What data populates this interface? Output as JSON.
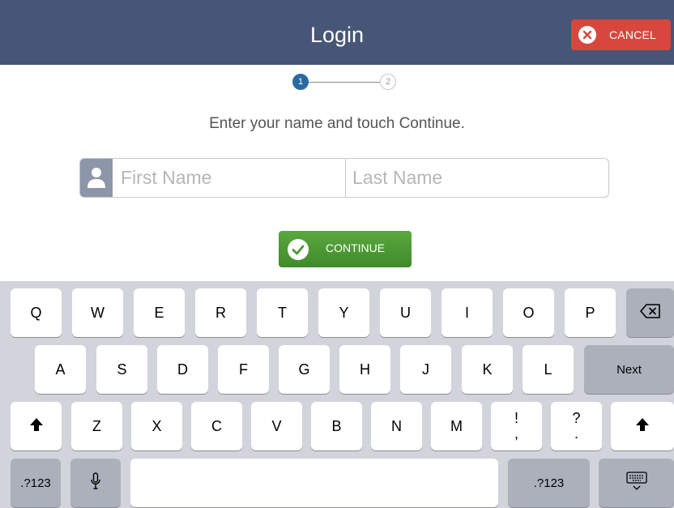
{
  "header": {
    "title": "Login",
    "cancel_label": "CANCEL"
  },
  "steps": [
    "1",
    "2"
  ],
  "instruction": "Enter your name and touch Continue.",
  "form": {
    "first_name_placeholder": "First Name",
    "last_name_placeholder": "Last Name"
  },
  "continue_label": "CONTINUE",
  "keyboard": {
    "row1": [
      "Q",
      "W",
      "E",
      "R",
      "T",
      "Y",
      "U",
      "I",
      "O",
      "P"
    ],
    "row2": [
      "A",
      "S",
      "D",
      "F",
      "G",
      "H",
      "J",
      "K",
      "L"
    ],
    "row3": [
      "Z",
      "X",
      "C",
      "V",
      "B",
      "N",
      "M"
    ],
    "punct1": [
      "!",
      ","
    ],
    "punct2": [
      "?",
      "."
    ],
    "next_label": "Next",
    "numbers_label": ".?123"
  },
  "colors": {
    "header_bg": "#475677",
    "cancel_bg": "#d7473e",
    "step_active": "#2b6aa1",
    "continue_bg": "#4a9a33",
    "keyboard_bg": "#d1d4da"
  },
  "icons": [
    "close-icon",
    "user-icon",
    "checkmark-icon",
    "backspace-icon",
    "shift-icon",
    "microphone-icon",
    "keyboard-dismiss-icon"
  ]
}
